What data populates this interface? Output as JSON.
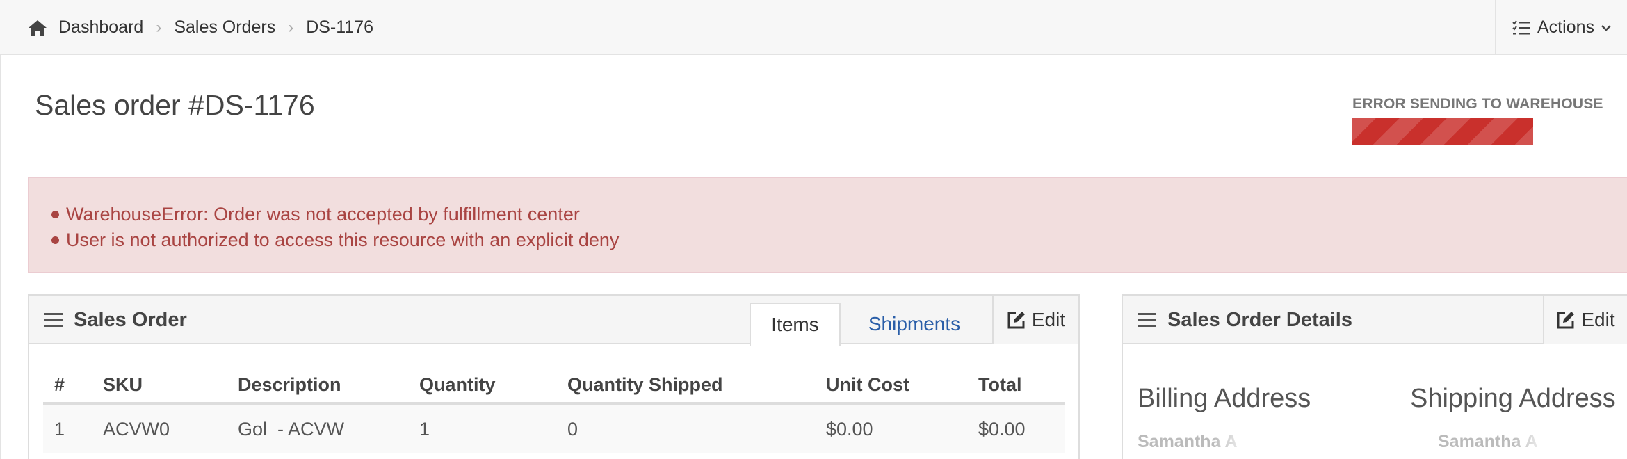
{
  "breadcrumb": {
    "items": [
      "Dashboard",
      "Sales Orders",
      "DS-1176"
    ],
    "separator": ">"
  },
  "actions": {
    "label": "Actions"
  },
  "page": {
    "title": "Sales order #DS-1176"
  },
  "status": {
    "label": "ERROR SENDING TO WAREHOUSE",
    "color": "#c9302c"
  },
  "alert": {
    "messages": [
      "WarehouseError: Order was not accepted by fulfillment center",
      "User is not authorized to access this resource with an explicit deny"
    ],
    "color": "#a94442",
    "background": "#f2dede"
  },
  "sales_order_panel": {
    "title": "Sales Order",
    "tabs": [
      "Items",
      "Shipments"
    ],
    "edit_label": "Edit",
    "columns": [
      "#",
      "SKU",
      "Description",
      "Quantity",
      "Quantity Shipped",
      "Unit Cost",
      "Total"
    ],
    "rows": [
      [
        "1",
        "ACVW0",
        "Gol  - ACVW",
        "1",
        "0",
        "$0.00",
        "$0.00"
      ]
    ]
  },
  "details_panel": {
    "title": "Sales Order Details",
    "edit_label": "Edit",
    "billing_title": "Billing Address",
    "shipping_title": "Shipping Address",
    "billing_name": "Samantha A",
    "shipping_name": "Samantha A"
  },
  "icons": {
    "home": "home-icon",
    "actions": "list-check-icon",
    "panel": "hamburger-menu-icon",
    "edit": "pencil-square-icon"
  }
}
